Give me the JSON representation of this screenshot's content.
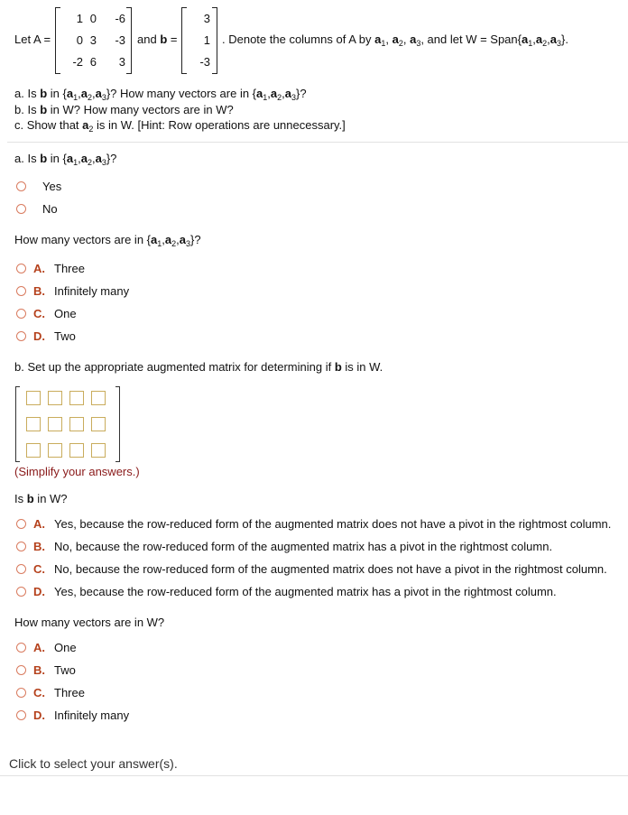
{
  "problem": {
    "let_label": "Let A =",
    "matrix_A": [
      [
        "1",
        "0",
        "-6"
      ],
      [
        "0",
        "3",
        "-3"
      ],
      [
        "-2",
        "6",
        "3"
      ]
    ],
    "and_label": "and",
    "b_label": "b",
    "equals": "=",
    "vector_b": [
      "3",
      "1",
      "-3"
    ],
    "statement_text": ". Denote the columns of A by a1, a2, a3, and let W = Span{a1,a2,a3}.",
    "parts": [
      "a. Is b in {a1,a2,a3}? How many vectors are in {a1,a2,a3}?",
      "b. Is b in W? How many vectors are in W?",
      "c. Show that a2 is in W. [Hint: Row operations are unnecessary.]"
    ]
  },
  "part_a": {
    "question": "a. Is b in {a1,a2,a3}?",
    "yes_no_options": [
      "Yes",
      "No"
    ],
    "count_question": "How many vectors are in {a1,a2,a3}?",
    "count_options": [
      {
        "letter": "A.",
        "text": "Three"
      },
      {
        "letter": "B.",
        "text": "Infinitely many"
      },
      {
        "letter": "C.",
        "text": "One"
      },
      {
        "letter": "D.",
        "text": "Two"
      }
    ]
  },
  "part_b": {
    "setup_prompt": "b. Set up the appropriate augmented matrix for determining if b is in W.",
    "augmented_matrix": {
      "rows": 3,
      "cols": 4,
      "values": [
        [
          "",
          "",
          "",
          ""
        ],
        [
          "",
          "",
          "",
          ""
        ],
        [
          "",
          "",
          "",
          ""
        ]
      ]
    },
    "hint": "(Simplify your answers.)",
    "in_w_question": "Is b in W?",
    "in_w_options": [
      {
        "letter": "A.",
        "text": "Yes, because the row-reduced form of the augmented matrix does not have a pivot in the rightmost column."
      },
      {
        "letter": "B.",
        "text": "No, because the row-reduced form of the augmented matrix has a pivot in the rightmost column."
      },
      {
        "letter": "C.",
        "text": "No, because the row-reduced form of the augmented matrix does not have a pivot in the rightmost column."
      },
      {
        "letter": "D.",
        "text": "Yes, because the row-reduced form of the augmented matrix has a pivot in the rightmost column."
      }
    ],
    "w_count_question": "How many vectors are in W?",
    "w_count_options": [
      {
        "letter": "A.",
        "text": "One"
      },
      {
        "letter": "B.",
        "text": "Two"
      },
      {
        "letter": "C.",
        "text": "Three"
      },
      {
        "letter": "D.",
        "text": "Infinitely many"
      }
    ]
  },
  "footer": {
    "instruction": "Click to select your answer(s)."
  },
  "colors": {
    "option_letter": "#b5411c",
    "radio_border": "#d97b5f",
    "input_border": "#c9ac5c",
    "hint": "#8a1a1a",
    "divider": "#e2e2e2"
  }
}
